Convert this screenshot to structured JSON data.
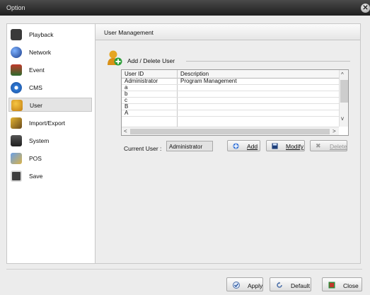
{
  "window": {
    "title": "Option",
    "close_glyph": "✕"
  },
  "sidebar": {
    "items": [
      {
        "label": "Playback",
        "icon": "film-icon"
      },
      {
        "label": "Network",
        "icon": "globe-icon"
      },
      {
        "label": "Event",
        "icon": "event-icon"
      },
      {
        "label": "CMS",
        "icon": "gear-cms-icon"
      },
      {
        "label": "User",
        "icon": "users-icon",
        "selected": true
      },
      {
        "label": "Import/Export",
        "icon": "import-export-icon"
      },
      {
        "label": "System",
        "icon": "system-icon"
      },
      {
        "label": "POS",
        "icon": "pos-icon"
      },
      {
        "label": "Save",
        "icon": "save-icon"
      }
    ]
  },
  "main": {
    "header": "User Management",
    "section_title": "Add / Delete User",
    "table": {
      "columns": [
        "User ID",
        "Description"
      ],
      "rows": [
        [
          "Administrator",
          "Program Management"
        ],
        [
          "a",
          ""
        ],
        [
          "b",
          ""
        ],
        [
          "c",
          ""
        ],
        [
          "B",
          ""
        ],
        [
          "A",
          ""
        ]
      ]
    },
    "current_user_label": "Current User :",
    "current_user_value": "Administrator",
    "buttons": {
      "add": "Add",
      "modify": "Modify",
      "delete": "Delete"
    }
  },
  "footer": {
    "apply": "Apply",
    "default": "Default",
    "close": "Close"
  },
  "colors": {
    "titlebar": "#2a2a2a",
    "accent_blue": "#2f6fd6",
    "selection": "#e4e4e4"
  }
}
